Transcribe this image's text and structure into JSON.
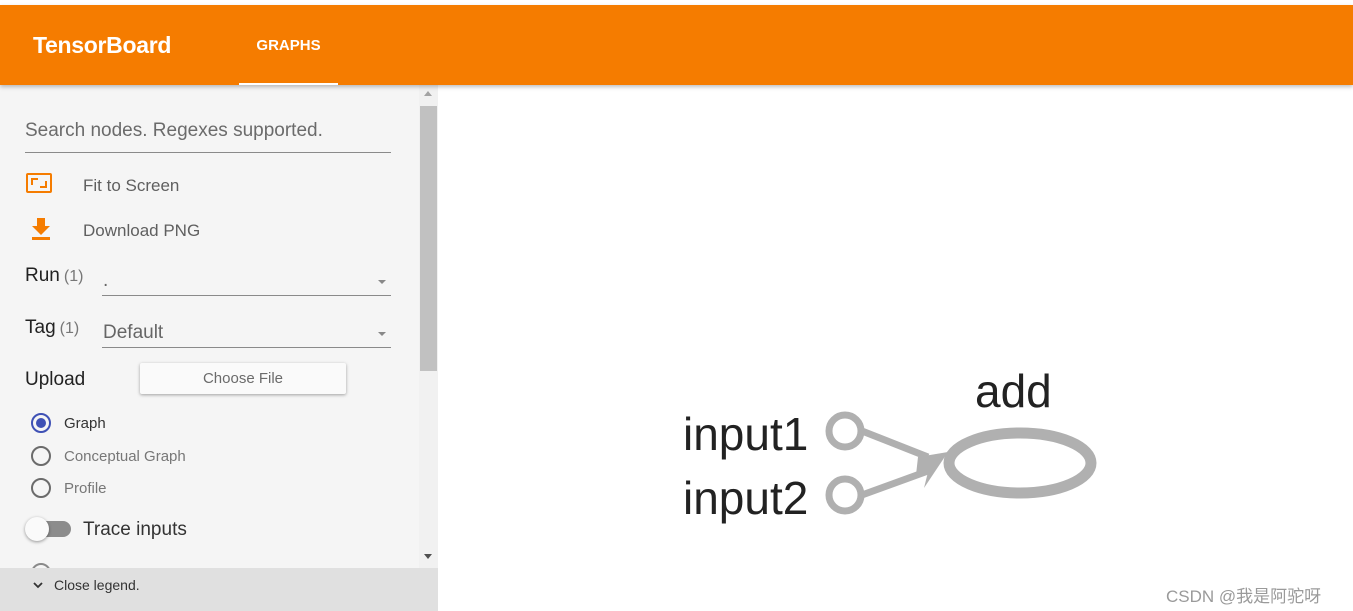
{
  "app": {
    "title": "TensorBoard",
    "tabs": [
      {
        "label": "GRAPHS",
        "active": true
      }
    ],
    "accent_color": "#f57c00"
  },
  "sidebar": {
    "search": {
      "placeholder": "Search nodes. Regexes supported.",
      "value": ""
    },
    "actions": [
      {
        "label": "Fit to Screen",
        "icon": "fit-to-screen-icon"
      },
      {
        "label": "Download PNG",
        "icon": "download-icon"
      }
    ],
    "run": {
      "label": "Run",
      "count": "(1)",
      "value": "."
    },
    "tag": {
      "label": "Tag",
      "count": "(1)",
      "value": "Default"
    },
    "upload": {
      "label": "Upload",
      "button_label": "Choose File"
    },
    "graph_types": [
      {
        "label": "Graph",
        "checked": true
      },
      {
        "label": "Conceptual Graph",
        "checked": false
      },
      {
        "label": "Profile",
        "checked": false
      }
    ],
    "trace_inputs": {
      "label": "Trace inputs",
      "enabled": false
    },
    "legend": {
      "label": "Close legend."
    }
  },
  "graph": {
    "nodes": [
      {
        "name": "input1",
        "kind": "placeholder"
      },
      {
        "name": "input2",
        "kind": "placeholder"
      },
      {
        "name": "add",
        "kind": "op"
      }
    ],
    "edges": [
      {
        "from": "input1",
        "to": "add"
      },
      {
        "from": "input2",
        "to": "add"
      }
    ],
    "node_color": "#b0b0b0"
  },
  "watermark": "CSDN @我是阿驼呀"
}
